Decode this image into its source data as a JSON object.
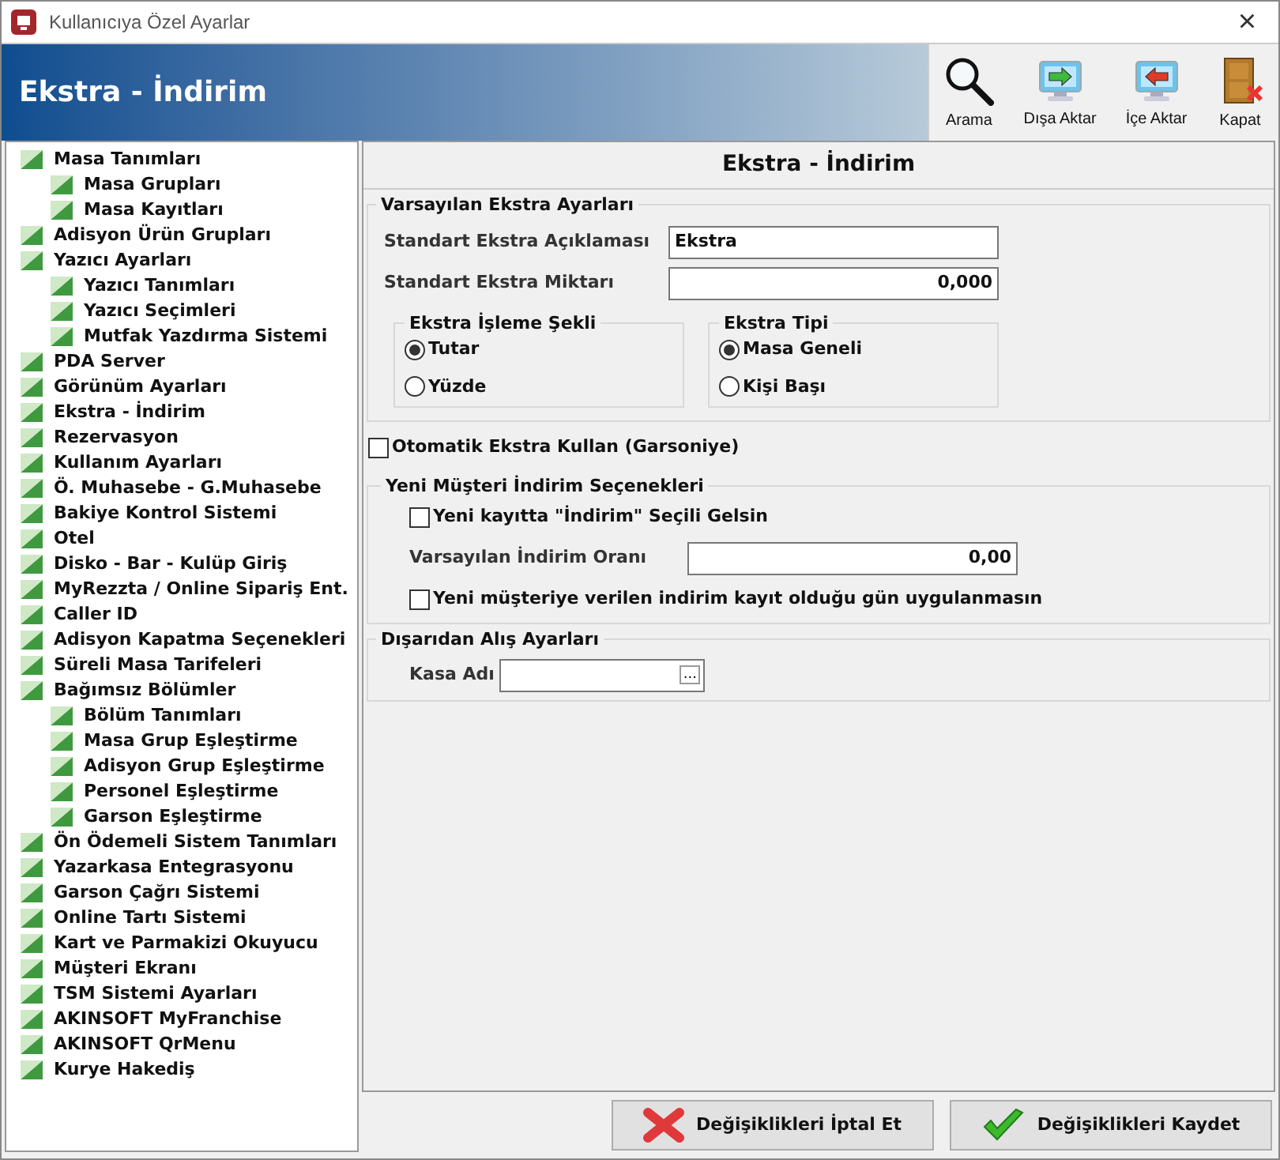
{
  "window": {
    "title": "Kullanıcıya Özel Ayarlar",
    "close": "×"
  },
  "header": {
    "title": "Ekstra - İndirim"
  },
  "toolbar": [
    {
      "label": "Arama",
      "kind": "search"
    },
    {
      "label": "Dışa Aktar",
      "kind": "export"
    },
    {
      "label": "İçe Aktar",
      "kind": "import"
    },
    {
      "label": "Kapat",
      "kind": "close"
    }
  ],
  "tree": [
    {
      "label": "Masa Tanımları",
      "children": [
        {
          "label": "Masa Grupları"
        },
        {
          "label": "Masa Kayıtları"
        }
      ]
    },
    {
      "label": "Adisyon Ürün Grupları"
    },
    {
      "label": "Yazıcı Ayarları",
      "children": [
        {
          "label": "Yazıcı Tanımları"
        },
        {
          "label": "Yazıcı Seçimleri"
        },
        {
          "label": "Mutfak Yazdırma Sistemi"
        }
      ]
    },
    {
      "label": "PDA Server"
    },
    {
      "label": "Görünüm Ayarları"
    },
    {
      "label": "Ekstra - İndirim"
    },
    {
      "label": "Rezervasyon"
    },
    {
      "label": "Kullanım Ayarları"
    },
    {
      "label": "Ö. Muhasebe - G.Muhasebe"
    },
    {
      "label": "Bakiye Kontrol Sistemi"
    },
    {
      "label": "Otel"
    },
    {
      "label": "Disko - Bar - Kulüp Giriş"
    },
    {
      "label": "MyRezzta / Online Sipariş Ent."
    },
    {
      "label": "Caller ID"
    },
    {
      "label": "Adisyon Kapatma Seçenekleri"
    },
    {
      "label": "Süreli Masa Tarifeleri"
    },
    {
      "label": "Bağımsız Bölümler",
      "children": [
        {
          "label": "Bölüm Tanımları"
        },
        {
          "label": "Masa Grup Eşleştirme"
        },
        {
          "label": "Adisyon Grup Eşleştirme"
        },
        {
          "label": "Personel Eşleştirme"
        },
        {
          "label": "Garson Eşleştirme"
        }
      ]
    },
    {
      "label": "Ön Ödemeli Sistem Tanımları"
    },
    {
      "label": "Yazarkasa Entegrasyonu"
    },
    {
      "label": "Garson Çağrı Sistemi"
    },
    {
      "label": "Online Tartı Sistemi"
    },
    {
      "label": "Kart ve Parmakizi Okuyucu"
    },
    {
      "label": "Müşteri Ekranı"
    },
    {
      "label": "TSM Sistemi Ayarları"
    },
    {
      "label": "AKINSOFT MyFranchise"
    },
    {
      "label": "AKINSOFT QrMenu"
    },
    {
      "label": "Kurye Hakediş"
    }
  ],
  "panel": {
    "title": "Ekstra - İndirim",
    "defaults": {
      "title": "Varsayılan Ekstra Ayarları",
      "fields": [
        {
          "label": "Standart Ekstra Açıklaması",
          "value": "Ekstra",
          "kind": "text"
        },
        {
          "label": "Standart Ekstra Miktarı",
          "value": "0,000",
          "kind": "number"
        }
      ],
      "groups": [
        {
          "title": "Ekstra İşleme Şekli",
          "options": [
            {
              "label": "Tutar",
              "selected": true
            },
            {
              "label": "Yüzde",
              "selected": false
            }
          ]
        },
        {
          "title": "Ekstra Tipi",
          "options": [
            {
              "label": "Masa Geneli",
              "selected": true
            },
            {
              "label": "Kişi Başı",
              "selected": false
            }
          ]
        }
      ]
    },
    "auto_extra": {
      "label": "Otomatik Ekstra Kullan (Garsoniye)",
      "checked": false
    },
    "new_customer": {
      "title": "Yeni Müşteri İndirim Seçenekleri",
      "rows": [
        {
          "kind": "checkbox",
          "label": "Yeni kayıtta \"İndirim\" Seçili Gelsin",
          "checked": false
        },
        {
          "kind": "field",
          "label": "Varsayılan İndirim Oranı",
          "value": "0,00"
        },
        {
          "kind": "checkbox",
          "label": "Yeni müşteriye verilen indirim kayıt olduğu gün uygulanmasın",
          "checked": false
        }
      ]
    },
    "external": {
      "title": "Dışarıdan Alış Ayarları",
      "field": {
        "label": "Kasa Adı",
        "button": "..."
      }
    }
  },
  "buttons": [
    {
      "label": "Değişiklikleri İptal Et",
      "kind": "cancel"
    },
    {
      "label": "Değişiklikleri Kaydet",
      "kind": "save"
    }
  ]
}
